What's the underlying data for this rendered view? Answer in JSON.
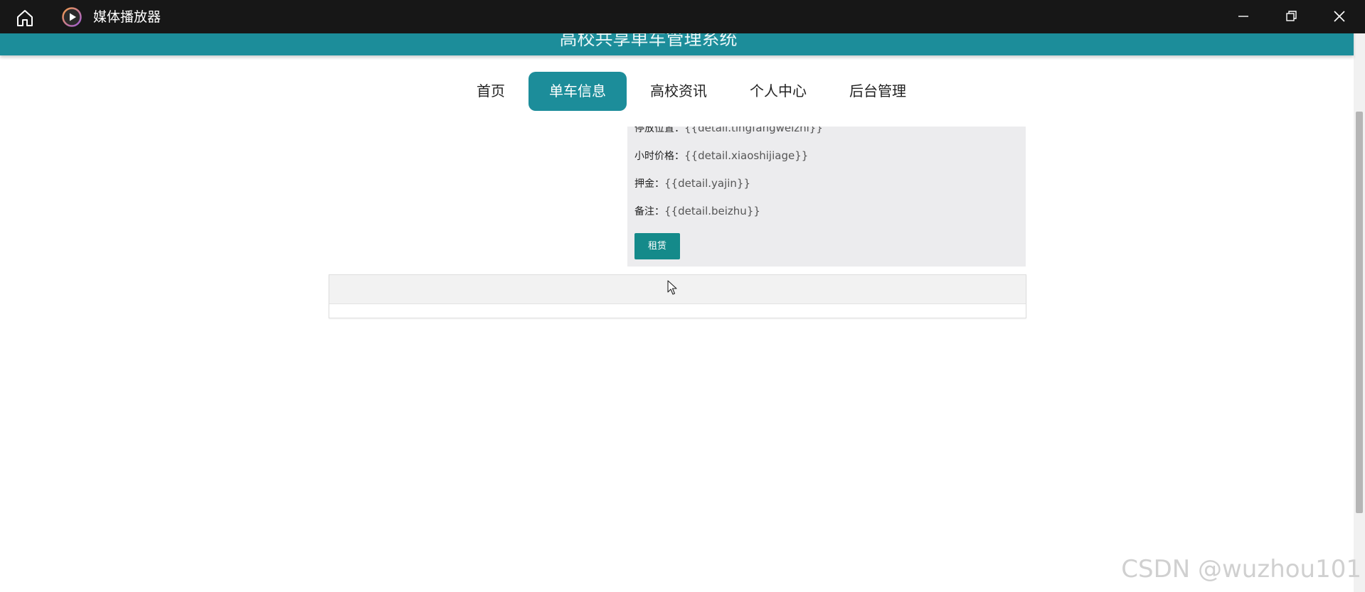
{
  "window": {
    "app_title": "媒体播放器"
  },
  "site": {
    "title": "高校共享单车管理系统"
  },
  "nav": {
    "items": [
      "首页",
      "单车信息",
      "高校资讯",
      "个人中心",
      "后台管理"
    ],
    "active": "单车信息"
  },
  "detail": {
    "rows": [
      {
        "label": "停放位置：",
        "value": "{{detail.tingfangweizhi}}"
      },
      {
        "label": "小时价格：",
        "value": "{{detail.xiaoshijiage}}"
      },
      {
        "label": "押金：",
        "value": "{{detail.yajin}}"
      },
      {
        "label": "备注：",
        "value": "{{detail.beizhu}}"
      }
    ],
    "rent_label": "租赁"
  },
  "watermark": "CSDN @wuzhou101",
  "colors": {
    "titlebar": "#171717",
    "header": "#1c8d9a",
    "nav_active": "#1c8d9a",
    "panel_bg": "#ececee",
    "rent_button": "#148a8a"
  }
}
